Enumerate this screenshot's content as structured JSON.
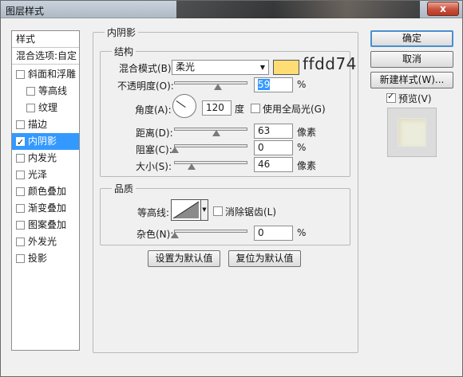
{
  "window": {
    "title": "图层样式",
    "close_label": "x"
  },
  "style_list": {
    "header": "样式",
    "blend_options": "混合选项:自定",
    "items": [
      {
        "label": "斜面和浮雕",
        "checked": false,
        "indent": false
      },
      {
        "label": "等高线",
        "checked": false,
        "indent": true
      },
      {
        "label": "纹理",
        "checked": false,
        "indent": true
      },
      {
        "label": "描边",
        "checked": false,
        "indent": false
      },
      {
        "label": "内阴影",
        "checked": true,
        "indent": false,
        "selected": true
      },
      {
        "label": "内发光",
        "checked": false,
        "indent": false
      },
      {
        "label": "光泽",
        "checked": false,
        "indent": false
      },
      {
        "label": "颜色叠加",
        "checked": false,
        "indent": false
      },
      {
        "label": "渐变叠加",
        "checked": false,
        "indent": false
      },
      {
        "label": "图案叠加",
        "checked": false,
        "indent": false
      },
      {
        "label": "外发光",
        "checked": false,
        "indent": false
      },
      {
        "label": "投影",
        "checked": false,
        "indent": false
      }
    ]
  },
  "panel": {
    "section_title": "内阴影",
    "structure": {
      "title": "结构",
      "blend_mode_label": "混合模式(B):",
      "blend_mode_value": "柔光",
      "swatch_color": "#ffdd74",
      "hex_note": "ffdd74",
      "opacity_label": "不透明度(O):",
      "opacity_value": "59",
      "opacity_unit": "%",
      "opacity_level": 0.59,
      "angle_label": "角度(A):",
      "angle_value": "120",
      "angle_unit": "度",
      "global_light_label": "使用全局光(G)",
      "global_light_checked": false,
      "distance_label": "距离(D):",
      "distance_value": "63",
      "distance_unit": "像素",
      "choke_label": "阻塞(C):",
      "choke_value": "0",
      "choke_unit": "%",
      "size_label": "大小(S):",
      "size_value": "46",
      "size_unit": "像素"
    },
    "quality": {
      "title": "品质",
      "contour_label": "等高线:",
      "anti_alias_label": "消除锯齿(L)",
      "anti_alias_checked": false,
      "noise_label": "杂色(N):",
      "noise_value": "0",
      "noise_unit": "%"
    },
    "make_default_label": "设置为默认值",
    "reset_default_label": "复位为默认值"
  },
  "buttons": {
    "ok": "确定",
    "cancel": "取消",
    "new_style": "新建样式(W)...",
    "preview_label": "预览(V)",
    "preview_checked": true
  }
}
